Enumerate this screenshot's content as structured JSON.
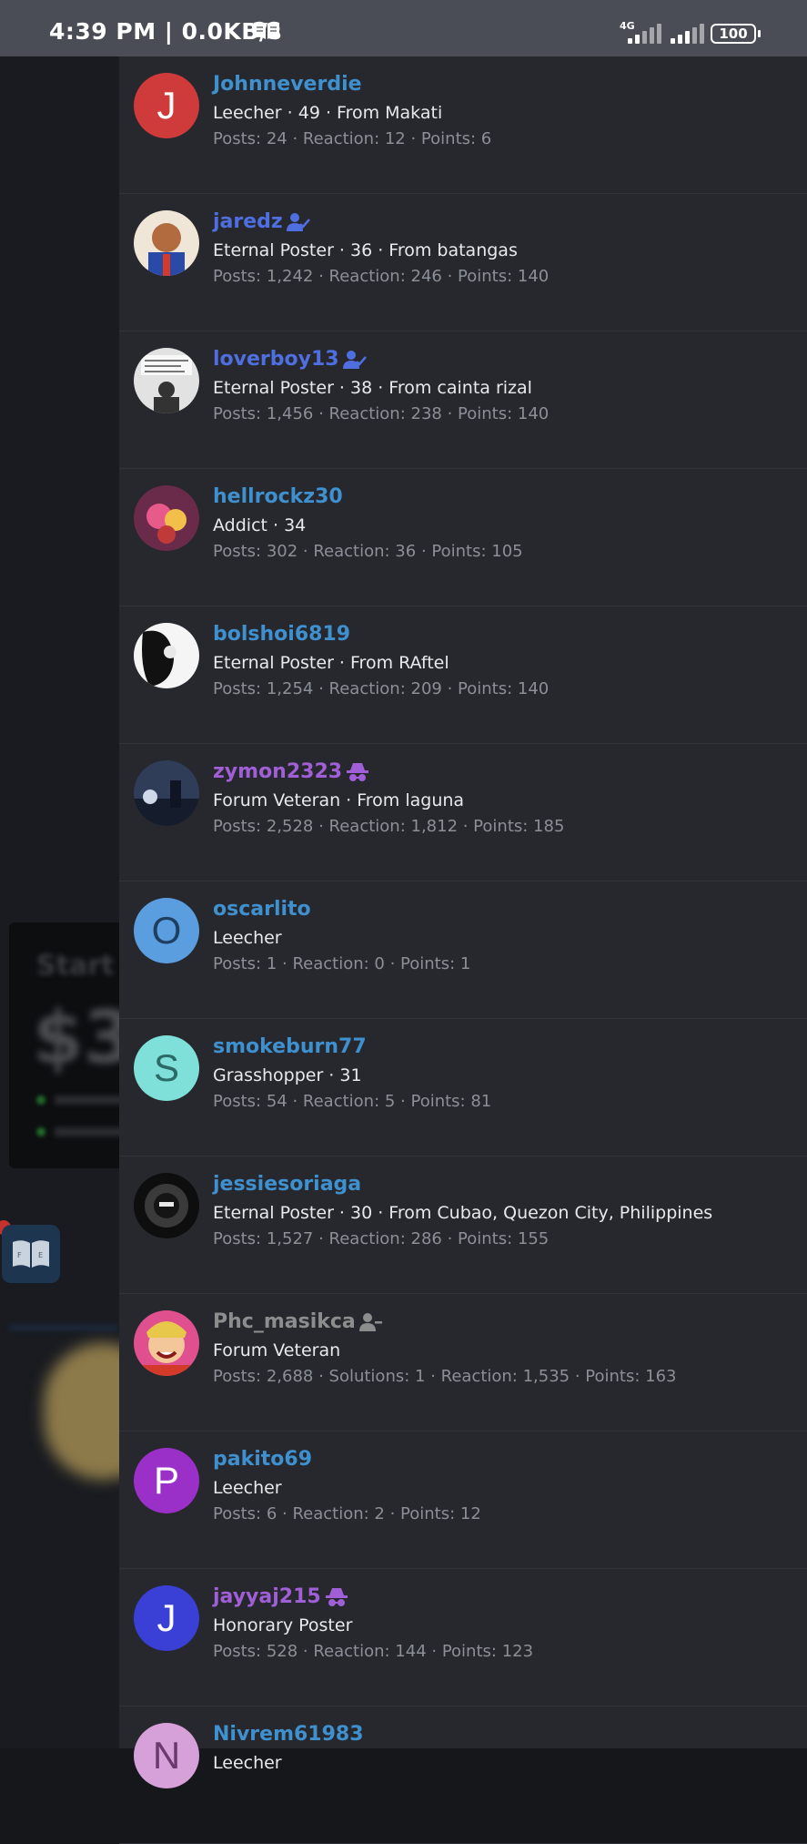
{
  "status_bar": {
    "time": "4:39 PM | 0.0KB/s",
    "network": "4G",
    "battery": "100"
  },
  "members": [
    {
      "name": "Johnneverdie",
      "name_color": "#3f90cf",
      "badge": "",
      "line1": "Leecher · 49 · From Makati",
      "line2": "Posts: 24 · Reaction: 12 · Points: 6",
      "avatar_type": "letter",
      "avatar_letter": "J",
      "avatar_bg": "#cf3a3a",
      "avatar_fg": "#ffffff"
    },
    {
      "name": "jaredz",
      "name_color": "#4f6fe0",
      "badge": "verified-user-icon",
      "line1": "Eternal Poster · 36 · From batangas",
      "line2": "Posts: 1,242 · Reaction: 246 · Points: 140",
      "avatar_type": "photo",
      "avatar_letter": "",
      "avatar_bg": "#b26b3e",
      "avatar_fg": ""
    },
    {
      "name": "loverboy13",
      "name_color": "#4f6fe0",
      "badge": "verified-user-icon",
      "line1": "Eternal Poster · 38 · From cainta rizal",
      "line2": "Posts: 1,456 · Reaction: 238 · Points: 140",
      "avatar_type": "photo",
      "avatar_letter": "",
      "avatar_bg": "#d7d7d7",
      "avatar_fg": ""
    },
    {
      "name": "hellrockz30",
      "name_color": "#3f90cf",
      "badge": "",
      "line1": "Addict · 34",
      "line2": "Posts: 302 · Reaction: 36 · Points: 105",
      "avatar_type": "photo",
      "avatar_letter": "",
      "avatar_bg": "#8a4a6a",
      "avatar_fg": ""
    },
    {
      "name": "bolshoi6819",
      "name_color": "#3f90cf",
      "badge": "",
      "line1": "Eternal Poster · From RAftel",
      "line2": "Posts: 1,254 · Reaction: 209 · Points: 140",
      "avatar_type": "photo",
      "avatar_letter": "",
      "avatar_bg": "#f2f2f2",
      "avatar_fg": ""
    },
    {
      "name": "zymon2323",
      "name_color": "#a05fd6",
      "badge": "incognito-icon",
      "line1": "Forum Veteran · From laguna",
      "line2": "Posts: 2,528 · Reaction: 1,812 · Points: 185",
      "avatar_type": "photo",
      "avatar_letter": "",
      "avatar_bg": "#3d4f6f",
      "avatar_fg": ""
    },
    {
      "name": "oscarlito",
      "name_color": "#3f90cf",
      "badge": "",
      "line1": "Leecher",
      "line2": "Posts: 1 · Reaction: 0 · Points: 1",
      "avatar_type": "letter",
      "avatar_letter": "O",
      "avatar_bg": "#5a9ee0",
      "avatar_fg": "#1f3f60"
    },
    {
      "name": "smokeburn77",
      "name_color": "#3f90cf",
      "badge": "",
      "line1": "Grasshopper · 31",
      "line2": "Posts: 54 · Reaction: 5 · Points: 81",
      "avatar_type": "letter",
      "avatar_letter": "S",
      "avatar_bg": "#7fe0da",
      "avatar_fg": "#2b6a66"
    },
    {
      "name": "jessiesoriaga",
      "name_color": "#3f90cf",
      "badge": "",
      "line1": "Eternal Poster · 30 · From Cubao, Quezon City, Philippines",
      "line2": "Posts: 1,527 · Reaction: 286 · Points: 155",
      "avatar_type": "photo",
      "avatar_letter": "",
      "avatar_bg": "#1a1a1a",
      "avatar_fg": ""
    },
    {
      "name": "Phc_masikca",
      "name_color": "#8d8d8d",
      "badge": "user-minus-icon",
      "line1": "Forum Veteran",
      "line2": "Posts: 2,688 · Solutions: 1 · Reaction: 1,535 · Points: 163",
      "avatar_type": "photo",
      "avatar_letter": "",
      "avatar_bg": "#d05a9a",
      "avatar_fg": ""
    },
    {
      "name": "pakito69",
      "name_color": "#3f90cf",
      "badge": "",
      "line1": "Leecher",
      "line2": "Posts: 6 · Reaction: 2 · Points: 12",
      "avatar_type": "letter",
      "avatar_letter": "P",
      "avatar_bg": "#9b30c9",
      "avatar_fg": "#ffffff"
    },
    {
      "name": "jayyaj215",
      "name_color": "#a05fd6",
      "badge": "incognito-icon",
      "line1": "Honorary Poster",
      "line2": "Posts: 528 · Reaction: 144 · Points: 123",
      "avatar_type": "letter",
      "avatar_letter": "J",
      "avatar_bg": "#3a3fd6",
      "avatar_fg": "#ffffff"
    },
    {
      "name": "Nivrem61983",
      "name_color": "#3f90cf",
      "badge": "",
      "line1": "Leecher",
      "line2": "",
      "avatar_type": "letter",
      "avatar_letter": "N",
      "avatar_bg": "#d6a0d8",
      "avatar_fg": "#6a3a6c"
    }
  ]
}
